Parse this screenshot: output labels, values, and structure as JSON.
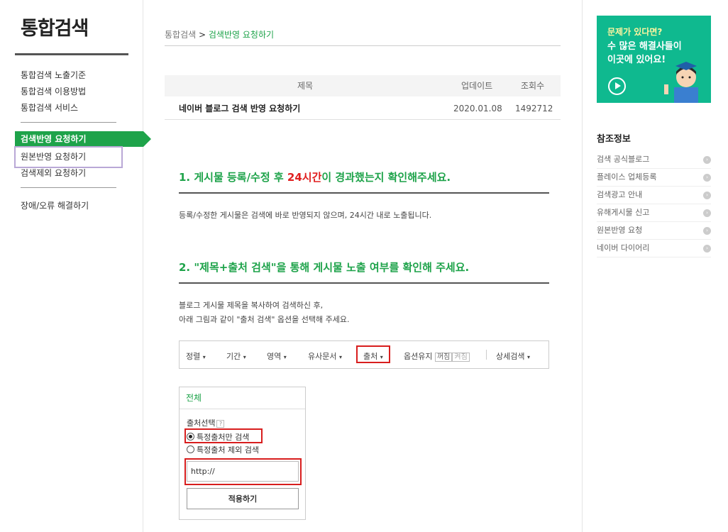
{
  "sidebar": {
    "title": "통합검색",
    "items": [
      "통합검색 노출기준",
      "통합검색 이용방법",
      "통합검색 서비스"
    ],
    "active": "검색반영 요청하기",
    "sub_items": [
      "원본반영 요청하기",
      "검색제외 요청하기"
    ],
    "last_item": "장애/오류 해결하기",
    "highlight_color": "#b9a8d6"
  },
  "breadcrumb": {
    "root": "통합검색",
    "sep": ">",
    "current": "검색반영 요청하기"
  },
  "table": {
    "headers": [
      "제목",
      "업데이트",
      "조회수"
    ],
    "row": {
      "title": "네이버 블로그 검색 반영 요청하기",
      "updated": "2020.01.08",
      "views": "1492712"
    }
  },
  "section1": {
    "heading_pre": "1. 게시물 등록/수정 후 ",
    "heading_red": "24시간",
    "heading_post": "이 경과했는지 확인해주세요.",
    "body": "등록/수정한 게시물은 검색에 바로 반영되지 않으며, 24시간 내로 노출됩니다."
  },
  "section2": {
    "heading": "2. \"제목+출처 검색\"을 통해 게시물 노출 여부를 확인해 주세요.",
    "body_line1": "블로그 게시물 제목을 복사하여 검색하신 후,",
    "body_line2": "아래 그림과 같이 \"출처 검색\" 옵션을 선택해 주세요."
  },
  "option_bar": {
    "sort": "정렬",
    "period": "기간",
    "area": "영역",
    "similar": "유사문서",
    "source": "출처",
    "keep": "옵션유지",
    "off": "꺼짐",
    "on": "켜짐",
    "detail": "상세검색",
    "caret": "▾"
  },
  "source_panel": {
    "header": "전체",
    "label": "출처선택",
    "help": "?",
    "radio_only": "특정출처만 검색",
    "radio_exclude": "특정출처 제외 검색",
    "input_value": "http://",
    "apply": "적용하기"
  },
  "banner": {
    "line1": "문제가 있다면?",
    "line2": "수 많은 해결사들이",
    "line3": "이곳에 있어요!",
    "bg_color": "#0fb98f"
  },
  "reference": {
    "title": "참조정보",
    "items": [
      "검색 공식블로그",
      "플레이스 업체등록",
      "검색광고 안내",
      "유해게시물 신고",
      "원본반영 요청",
      "네이버 다이어리"
    ],
    "arrow": "›"
  },
  "colors": {
    "accent": "#1ea34a",
    "highlight_red": "#d81e1e",
    "heading_red": "#e02020"
  }
}
